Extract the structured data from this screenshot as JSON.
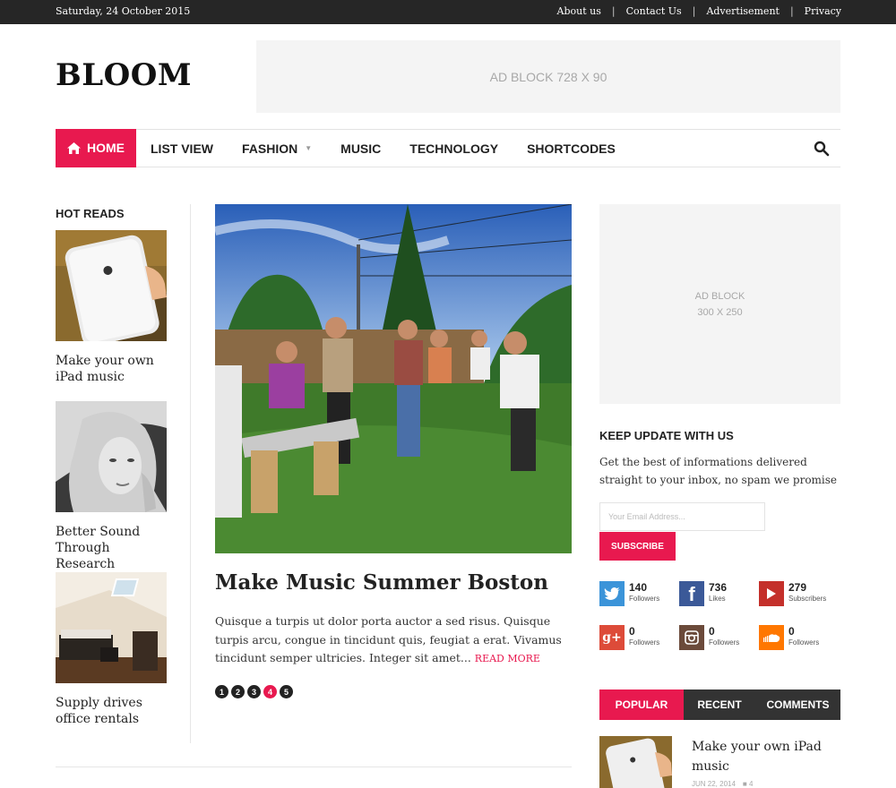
{
  "topbar": {
    "date": "Saturday, 24 October 2015",
    "links": [
      "About us",
      "Contact Us",
      "Advertisement",
      "Privacy"
    ]
  },
  "header": {
    "logo": "BLOOM",
    "ad_text": "AD BLOCK 728 X 90"
  },
  "nav": {
    "home": "HOME",
    "items": [
      "LIST VIEW",
      "FASHION",
      "MUSIC",
      "TECHNOLOGY",
      "SHORTCODES"
    ],
    "icons": {
      "home": "home-icon",
      "search": "search-icon",
      "fashion_caret": "caret-down-icon"
    }
  },
  "hot_reads": {
    "title": "HOT READS",
    "items": [
      {
        "caption": "Make your own iPad music"
      },
      {
        "caption": "Better Sound Through Research"
      },
      {
        "caption": "Supply drives office rentals"
      }
    ]
  },
  "featured": {
    "title": "Make Music Summer Boston",
    "excerpt": "Quisque a turpis ut dolor porta auctor a sed risus. Quisque turpis arcu, congue in tincidunt quis, feugiat a erat. Vivamus tincidunt semper ultricies. Integer sit amet...",
    "read_more": "READ MORE",
    "pages": [
      "1",
      "2",
      "3",
      "4",
      "5"
    ],
    "active_page": "4"
  },
  "sidebar": {
    "ad_line1": "AD BLOCK",
    "ad_line2": "300 X 250",
    "keep_title": "KEEP UPDATE WITH US",
    "keep_desc": "Get the best of informations delivered straight to your inbox, no spam we promise",
    "email_placeholder": "Your Email Address...",
    "subscribe": "SUBSCRIBE",
    "social": [
      {
        "icon": "twitter-icon",
        "count": "140",
        "label": "Followers",
        "color": "#3b94d9"
      },
      {
        "icon": "facebook-icon",
        "count": "736",
        "label": "Likes",
        "color": "#3b5998"
      },
      {
        "icon": "youtube-icon",
        "count": "279",
        "label": "Subscribers",
        "color": "#c4302b"
      },
      {
        "icon": "google-plus-icon",
        "count": "0",
        "label": "Followers",
        "color": "#dd4b39"
      },
      {
        "icon": "instagram-icon",
        "count": "0",
        "label": "Followers",
        "color": "#6b4a3a"
      },
      {
        "icon": "soundcloud-icon",
        "count": "0",
        "label": "Followers",
        "color": "#ff7700"
      }
    ],
    "tabs": [
      "POPULAR",
      "RECENT",
      "COMMENTS"
    ],
    "popular": {
      "title": "Make your own iPad music",
      "date": "JUN 22, 2014",
      "comments": "4"
    }
  },
  "colors": {
    "accent": "#e8194f",
    "dark": "#262626"
  }
}
